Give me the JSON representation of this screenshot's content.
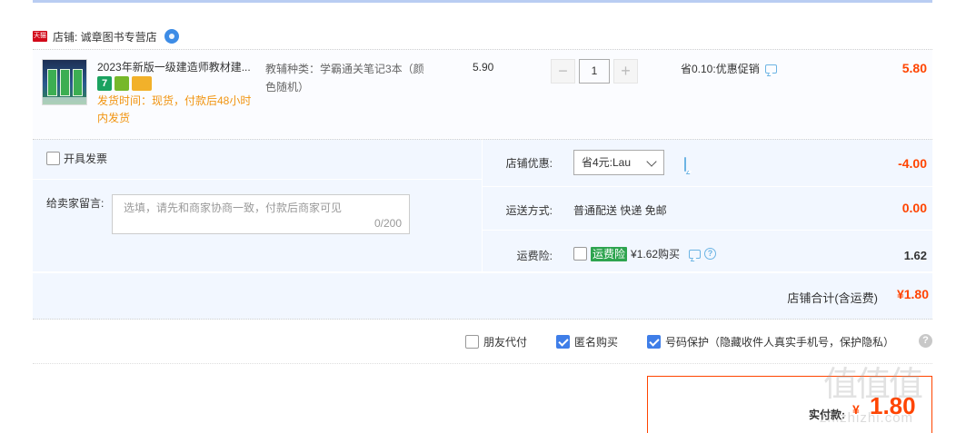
{
  "shop": {
    "badge": "天猫",
    "label": "店铺: 诚章图书专营店"
  },
  "item": {
    "title": "2023年新版一级建造师教材建...",
    "svc_icons": [
      "7",
      "",
      ""
    ],
    "ship_time": "发货时间：现货，付款后48小时内发货",
    "sku": "教辅种类：学霸通关笔记3本（颜色随机）",
    "unit_price": "5.90",
    "qty": {
      "minus": "−",
      "value": "1",
      "plus": "+"
    },
    "discount": "省0.10:优惠促销",
    "total": "5.80"
  },
  "options": {
    "invoice_label": "开具发票",
    "message_label": "给卖家留言:",
    "message_placeholder": "选填，请先和商家协商一致，付款后商家可见",
    "message_count": "0/200",
    "shop_discount_label": "店铺优惠:",
    "shop_discount_value": "省4元:Lau",
    "shop_discount_amount": "-4.00",
    "shipping_label": "运送方式:",
    "shipping_value": "普通配送 快递 免邮",
    "shipping_amount": "0.00",
    "insurance_label": "运费险:",
    "insurance_tag": "运费险",
    "insurance_text": "¥1.62购买",
    "insurance_amount": "1.62"
  },
  "subtotal": {
    "label": "店铺合计(含运费)",
    "amount": "¥1.80"
  },
  "order_options": [
    {
      "label": "朋友代付",
      "checked": false
    },
    {
      "label": "匿名购买",
      "checked": true
    },
    {
      "label": "号码保护（隐藏收件人真实手机号，保护隐私）",
      "checked": true
    }
  ],
  "payment": {
    "label": "实付款:",
    "currency": "¥",
    "amount": "1.80"
  },
  "watermark": {
    "main": "值值值",
    "sub": "zhizhizhi.com"
  },
  "colors": {
    "price_red": "#ff4400",
    "accent_blue": "#3f7ee8",
    "panel_bg": "#f2f7ff",
    "ship_orange": "#f19410",
    "insurance_green": "#2ea44f"
  }
}
